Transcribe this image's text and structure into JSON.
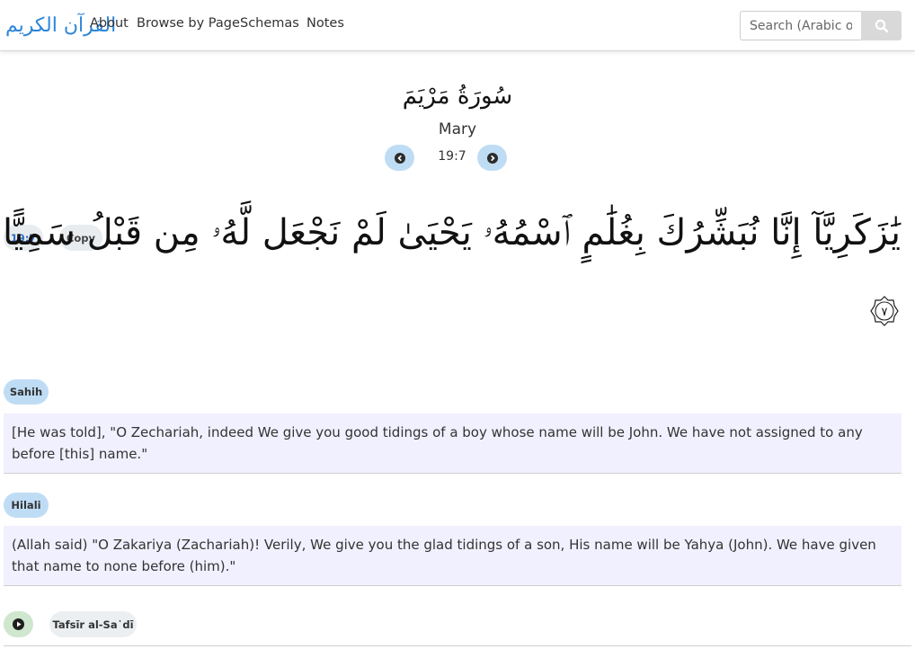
{
  "nav": {
    "logo_text": "القرآن الكريم",
    "links": [
      "About",
      "Browse by Page",
      "Schemas",
      "Notes"
    ],
    "search_placeholder": "Search (Arabic or"
  },
  "surah": {
    "name_ar": "سُورَةُ مَرْيَمَ",
    "name_en": "Mary",
    "ayah_ref": "19:7"
  },
  "ayah": {
    "ref_label": "19:7",
    "copy_label": "Copy",
    "text": "يَٰزَكَرِيَّآ إِنَّا نُبَشِّرُكَ بِغُلَٰمٍ ٱسْمُهُۥ يَحْيَىٰ لَمْ نَجْعَل لَّهُۥ مِن قَبْلُ سَمِيًّا",
    "marker": "٧"
  },
  "translations": [
    {
      "label": "Sahih",
      "text": "[He was told], \"O Zechariah, indeed We give you good tidings of a boy whose name will be John. We have not assigned to any before [this] name.\""
    },
    {
      "label": "Hilali",
      "text": "(Allah said) \"O Zakariya (Zachariah)! Verily, We give you the glad tidings of a son, His name will be Yahya (John). We have given that name to none before (him).\""
    }
  ],
  "tafsir": {
    "label": "Tafsīr al-Sa῾dī"
  },
  "colors": {
    "accent_blue": "#bfdcf5",
    "link_blue": "#2d6ec0",
    "translation_bg": "#f1f0ff",
    "play_green": "#cfe6cf"
  }
}
